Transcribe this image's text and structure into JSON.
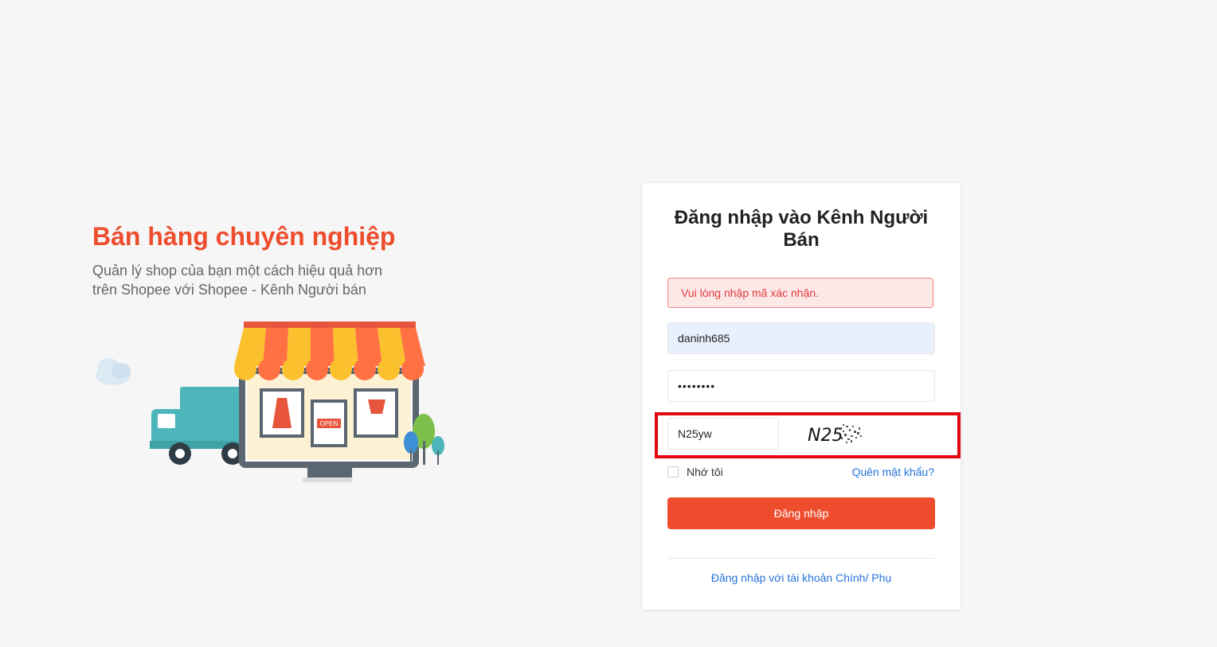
{
  "promo": {
    "title": "Bán hàng chuyên nghiệp",
    "subtitle": "Quản lý shop của bạn một cách hiệu quả hơn trên Shopee với Shopee - Kênh Người bán",
    "shop_sign": "OPEN"
  },
  "login": {
    "title": "Đăng nhập vào Kênh Người Bán",
    "error_message": "Vui lòng nhập mã xác nhận.",
    "username_value": "daninh685",
    "password_value": "••••••••",
    "captcha_value": "N25yw",
    "captcha_image_text": "N25",
    "remember_label": "Nhớ tôi",
    "forgot_password_label": "Quên mật khẩu?",
    "login_button_label": "Đăng nhập",
    "sub_account_link": "Đăng nhập với tài khoản Chính/ Phụ"
  },
  "colors": {
    "brand": "#ee4d2d",
    "link": "#2673dd",
    "highlight": "#e30613",
    "error_bg": "#fde8e8"
  }
}
